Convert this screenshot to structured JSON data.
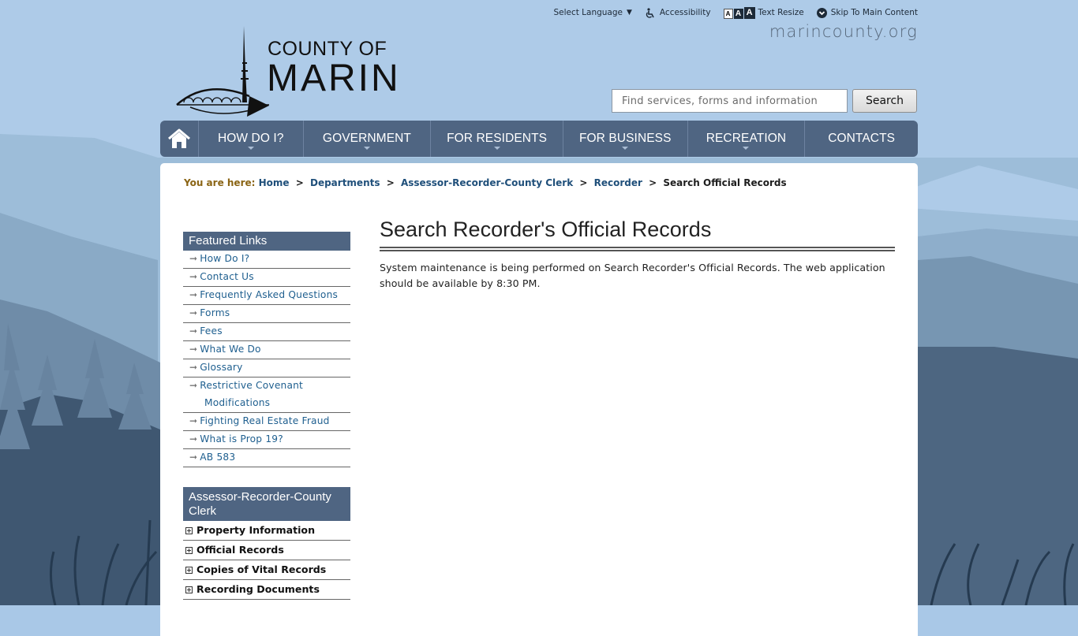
{
  "utility": {
    "language": "Select Language",
    "language_arrow": "▼",
    "accessibility": "Accessibility",
    "text_resize_letters": [
      "A",
      "A",
      "A"
    ],
    "text_resize": "Text Resize",
    "skip": "Skip To Main Content"
  },
  "site": {
    "domain": "marincounty.org",
    "logo_line1": "COUNTY OF",
    "logo_line2": "MARIN"
  },
  "search": {
    "placeholder": "Find services, forms and information",
    "button": "Search"
  },
  "nav": {
    "home_icon": "home-icon",
    "items": [
      {
        "label": "HOW DO I?"
      },
      {
        "label": "GOVERNMENT"
      },
      {
        "label": "FOR RESIDENTS"
      },
      {
        "label": "FOR BUSINESS"
      },
      {
        "label": "RECREATION"
      },
      {
        "label": "CONTACTS"
      }
    ]
  },
  "breadcrumb": {
    "prefix": "You are here:",
    "links": [
      "Home",
      "Departments",
      "Assessor-Recorder-County Clerk",
      "Recorder"
    ],
    "separator": ">",
    "current": "Search Official Records"
  },
  "featured": {
    "heading": "Featured Links",
    "arrow": "➞",
    "items": [
      "How Do I?",
      "Contact Us",
      "Frequently Asked Questions",
      "Forms",
      "Fees",
      "What We Do",
      "Glossary",
      "Restrictive Covenant",
      "Fighting Real Estate Fraud",
      "What is Prop 19?",
      "AB 583"
    ],
    "item_continuation": "Modifications"
  },
  "department": {
    "heading": "Assessor-Recorder-County Clerk",
    "items": [
      "Property Information",
      "Official Records",
      "Copies of Vital Records",
      "Recording Documents"
    ]
  },
  "main": {
    "title": "Search Recorder's Official Records",
    "message": "System maintenance is being performed on Search Recorder's Official Records. The web application should be available by 8:30 PM."
  },
  "colors": {
    "nav_bg": "#4f6582",
    "link": "#1f4f7a",
    "breadcrumb_prefix": "#8a6414",
    "sky": "#a9c8e7"
  }
}
